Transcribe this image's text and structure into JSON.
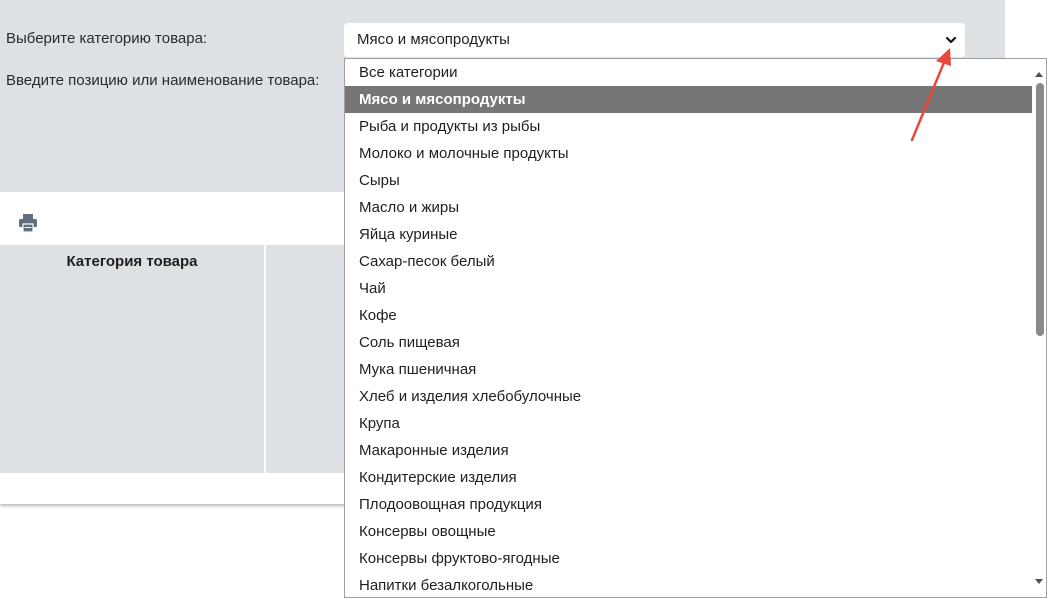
{
  "filter": {
    "category_label": "Выберите категорию товара:",
    "search_label": "Введите позицию или наименование товара:",
    "selected_category": "Мясо и мясопродукты"
  },
  "table": {
    "column_category": "Категория товара"
  },
  "dropdown": {
    "selected_index": 1,
    "options": [
      "Все категории",
      "Мясо и мясопродукты",
      "Рыба и продукты из рыбы",
      "Молоко и молочные продукты",
      "Сыры",
      "Масло и жиры",
      "Яйца куриные",
      "Сахар-песок белый",
      "Чай",
      "Кофе",
      "Соль пищевая",
      "Мука пшеничная",
      "Хлеб и изделия хлебобулочные",
      "Крупа",
      "Макаронные изделия",
      "Кондитерские изделия",
      "Плодоовощная продукция",
      "Консервы овощные",
      "Консервы фруктово-ягодные",
      "Напитки безалкогольные"
    ]
  },
  "icons": {
    "print": "printer-icon",
    "chevron": "chevron-down-icon",
    "annotation": "red-arrow-annotation"
  },
  "colors": {
    "panel_bg": "#dde1e4",
    "selected_option_bg": "#767676",
    "annotation_arrow": "#e8493b"
  }
}
